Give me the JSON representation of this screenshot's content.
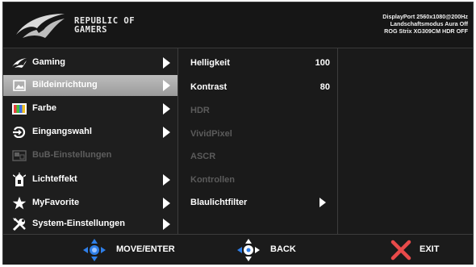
{
  "header": {
    "brand_line1": "REPUBLIC OF",
    "brand_line2": "GAMERS",
    "info_line1": "DisplayPort 2560x1080@200Hz",
    "info_line2": "Landschaftsmodus Aura Off",
    "info_line3": "ROG Strix XG309CM HDR OFF"
  },
  "main_menu": {
    "items": [
      {
        "label": "Gaming",
        "icon": "rog-eye-icon",
        "selected": false,
        "disabled": false
      },
      {
        "label": "Bildeinrichtung",
        "icon": "image-icon",
        "selected": true,
        "disabled": false
      },
      {
        "label": "Farbe",
        "icon": "color-bars-icon",
        "selected": false,
        "disabled": false
      },
      {
        "label": "Eingangswahl",
        "icon": "input-icon",
        "selected": false,
        "disabled": false
      },
      {
        "label": "BuB-Einstellungen",
        "icon": "pip-icon",
        "selected": false,
        "disabled": true
      },
      {
        "label": "Lichteffekt",
        "icon": "light-effect-icon",
        "selected": false,
        "disabled": false
      },
      {
        "label": "MyFavorite",
        "icon": "star-icon",
        "selected": false,
        "disabled": false
      },
      {
        "label": "System-Einstellungen",
        "icon": "tools-icon",
        "selected": false,
        "disabled": false
      }
    ]
  },
  "submenu": {
    "items": [
      {
        "label": "Helligkeit",
        "value": "100",
        "disabled": false
      },
      {
        "label": "Kontrast",
        "value": "80",
        "disabled": false
      },
      {
        "label": "HDR",
        "value": "",
        "disabled": true
      },
      {
        "label": "VividPixel",
        "value": "",
        "disabled": true
      },
      {
        "label": "ASCR",
        "value": "",
        "disabled": true
      },
      {
        "label": "Kontrollen",
        "value": "",
        "disabled": true
      },
      {
        "label": "Blaulichtfilter",
        "value": "",
        "disabled": false,
        "has_arrow": true
      }
    ]
  },
  "footer": {
    "move_enter": "MOVE/ENTER",
    "back": "BACK",
    "exit": "EXIT"
  },
  "colors": {
    "accent_blue": "#2f7fe8",
    "exit_red": "#e84a4a",
    "selected_gray": "#a8a8a8"
  }
}
